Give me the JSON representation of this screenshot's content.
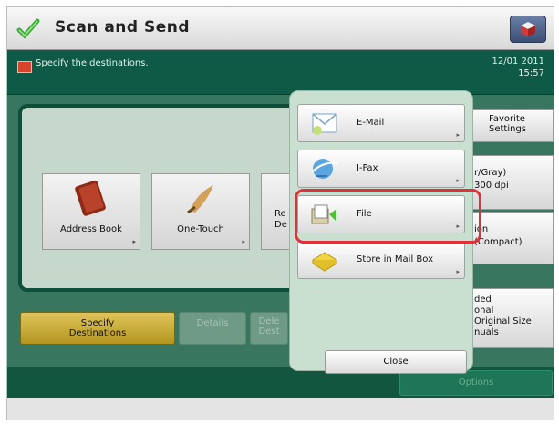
{
  "header": {
    "title": "Scan and Send",
    "app_icon": "scan-send-icon",
    "top_right_icon": "counter-check-icon"
  },
  "message_bar": {
    "text": "Specify the destinations.",
    "date": "12/01 2011",
    "time": "15:57"
  },
  "panel": {
    "tiles": [
      {
        "label": "Address Book",
        "icon": "address-book-icon"
      },
      {
        "label": "One-Touch",
        "icon": "one-touch-icon"
      },
      {
        "label": "Re\nDe",
        "icon": "recall-icon"
      }
    ]
  },
  "right_settings": [
    {
      "label": "Favorite\nSettings"
    },
    {
      "label": "r/Gray)\n300 dpi"
    },
    {
      "label": "ion\n(Compact)"
    },
    {
      "label": "ded\nonal\nOriginal Size\nnuals"
    }
  ],
  "tabs": [
    {
      "label": "Specify\nDestinations",
      "active": true
    },
    {
      "label": "Details",
      "active": false
    },
    {
      "label": "Dele\nDest",
      "active": false
    }
  ],
  "bottom_button": "Options",
  "dropdown": {
    "items": [
      {
        "label": "E-Mail",
        "icon": "email-icon"
      },
      {
        "label": "I-Fax",
        "icon": "ifax-icon"
      },
      {
        "label": "File",
        "icon": "file-icon",
        "highlighted": true
      },
      {
        "label": "Store in Mail Box",
        "icon": "mailbox-icon"
      }
    ],
    "close_label": "Close"
  },
  "colors": {
    "highlight": "#e0303a",
    "active_tab": "#cbb03b",
    "dark_green": "#0b4c3d"
  }
}
